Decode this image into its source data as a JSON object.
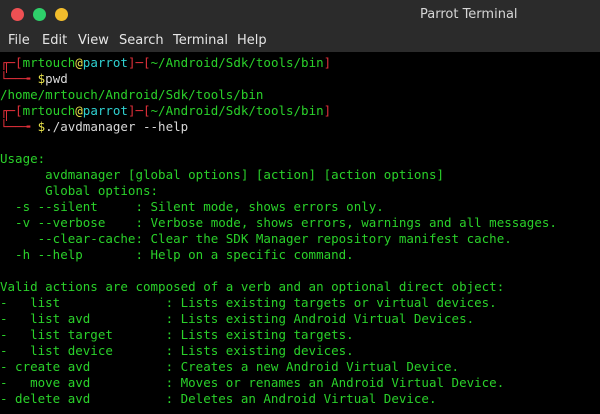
{
  "window": {
    "title": "Parrot Terminal"
  },
  "menu": [
    "File",
    "Edit",
    "View",
    "Search",
    "Terminal",
    "Help"
  ],
  "prompts": [
    {
      "user": "mrtouch",
      "at": "@",
      "host": "parrot",
      "path": "~/Android/Sdk/tools/bin",
      "command": "pwd"
    },
    {
      "user": "mrtouch",
      "at": "@",
      "host": "parrot",
      "path": "~/Android/Sdk/tools/bin",
      "command": "./avdmanager --help"
    }
  ],
  "pwd_output": "/home/mrtouch/Android/Sdk/tools/bin",
  "help_lines": [
    "Usage:",
    "      avdmanager [global options] [action] [action options]",
    "      Global options:",
    "  -s --silent     : Silent mode, shows errors only.",
    "  -v --verbose    : Verbose mode, shows errors, warnings and all messages.",
    "     --clear-cache: Clear the SDK Manager repository manifest cache.",
    "  -h --help       : Help on a specific command.",
    "",
    "Valid actions are composed of a verb and an optional direct object:",
    "-   list              : Lists existing targets or virtual devices.",
    "-   list avd          : Lists existing Android Virtual Devices.",
    "-   list target       : Lists existing targets.",
    "-   list device       : Lists existing devices.",
    "- create avd          : Creates a new Android Virtual Device.",
    "-   move avd          : Moves or renames an Android Virtual Device.",
    "- delete avd          : Deletes an Android Virtual Device."
  ]
}
